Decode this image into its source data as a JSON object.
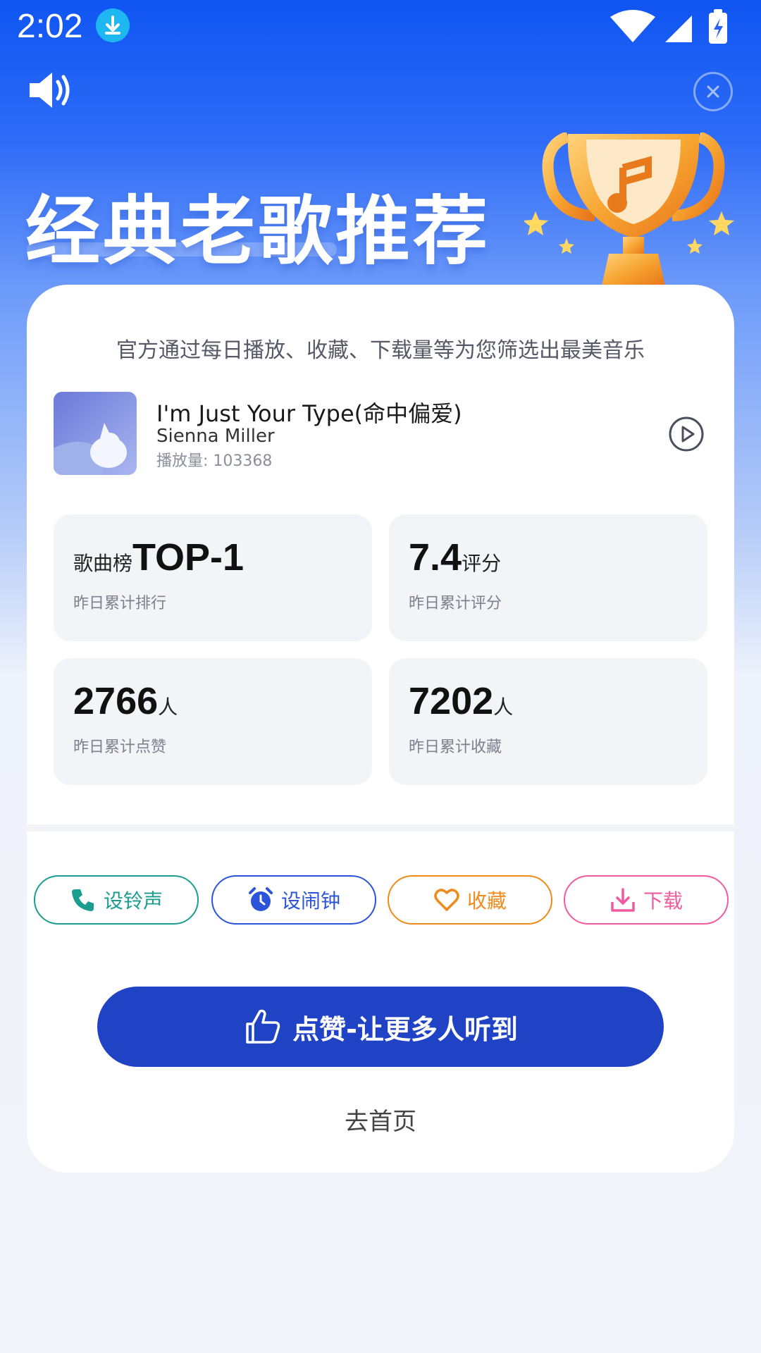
{
  "status_bar": {
    "time": "2:02",
    "icons": [
      "download-icon",
      "wifi-icon",
      "signal-icon",
      "battery-icon"
    ]
  },
  "header": {
    "title": "经典老歌推荐",
    "icons": [
      "speaker-icon",
      "close-icon",
      "trophy-icon"
    ]
  },
  "card": {
    "subtitle": "官方通过每日播放、收藏、下载量等为您筛选出最美音乐",
    "song": {
      "title": "I'm Just Your Type(命中偏爱)",
      "artist": "Sienna Miller",
      "plays": "播放量: 103368"
    },
    "stats": [
      {
        "prefix": "歌曲榜",
        "value": "TOP-1",
        "suffix": "",
        "label": "昨日累计排行"
      },
      {
        "prefix": "",
        "value": "7.4",
        "suffix": "评分",
        "label": "昨日累计评分"
      },
      {
        "prefix": "",
        "value": "2766",
        "suffix": "人",
        "label": "昨日累计点赞"
      },
      {
        "prefix": "",
        "value": "7202",
        "suffix": "人",
        "label": "昨日累计收藏"
      }
    ],
    "actions": [
      {
        "label": "设铃声",
        "icon": "phone-icon",
        "color": "#1a9d8f"
      },
      {
        "label": "设闹钟",
        "icon": "alarm-clock-icon",
        "color": "#2b54d9"
      },
      {
        "label": "收藏",
        "icon": "heart-icon",
        "color": "#f08a1a"
      },
      {
        "label": "下载",
        "icon": "download-icon",
        "color": "#f05a9e"
      }
    ],
    "cta_label": "点赞-让更多人听到",
    "cta_color": "#2042c4",
    "home_label": "去首页"
  }
}
